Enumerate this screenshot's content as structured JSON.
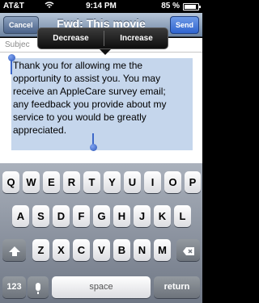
{
  "status_bar": {
    "carrier": "AT&T",
    "time": "9:14 PM",
    "battery_percent": "85 %",
    "battery_level": 0.85
  },
  "nav": {
    "cancel_label": "Cancel",
    "title": "Fwd: This movie",
    "send_label": "Send"
  },
  "subject": {
    "label": "Subjec"
  },
  "edit_menu": {
    "decrease_label": "Decrease",
    "increase_label": "Increase"
  },
  "body": {
    "lines": [
      "Thank you for allowing me the",
      "opportunity to assist you. You may",
      "receive an AppleCare survey email;",
      "any feedback you provide about my",
      "service to you would be greatly",
      "appreciated."
    ]
  },
  "keyboard": {
    "row1": [
      "Q",
      "W",
      "E",
      "R",
      "T",
      "Y",
      "U",
      "I",
      "O",
      "P"
    ],
    "row2": [
      "A",
      "S",
      "D",
      "F",
      "G",
      "H",
      "J",
      "K",
      "L"
    ],
    "row3": [
      "Z",
      "X",
      "C",
      "V",
      "B",
      "N",
      "M"
    ],
    "numbers_label": "123",
    "space_label": "space",
    "return_label": "return"
  }
}
